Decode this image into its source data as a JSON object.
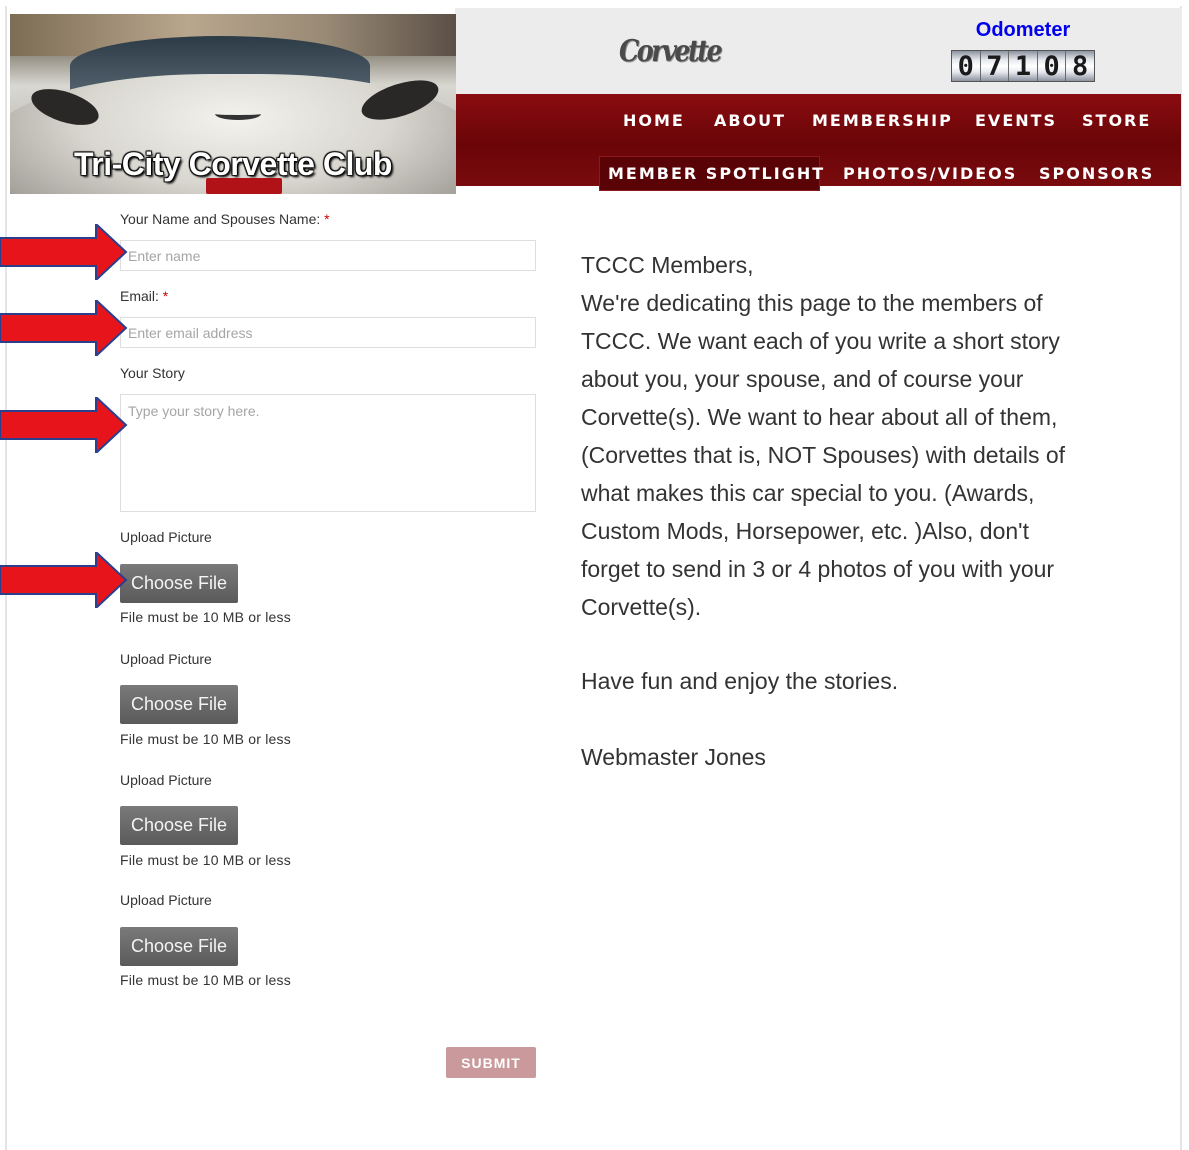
{
  "site": {
    "title": "Tri-City Corvette Club",
    "logo_text": "Corvette",
    "odometer_label": "Odometer",
    "odometer_digits": [
      "0",
      "7",
      "1",
      "0",
      "8"
    ]
  },
  "nav": {
    "row1": [
      "HOME",
      "ABOUT",
      "MEMBERSHIP",
      "EVENTS",
      "STORE"
    ],
    "row2": [
      "MEMBER SPOTLIGHT",
      "PHOTOS/VIDEOS",
      "SPONSORS"
    ],
    "active": "MEMBER SPOTLIGHT"
  },
  "form": {
    "name_label": "Your Name and Spouses Name:",
    "name_placeholder": "Enter name",
    "email_label": "Email:",
    "email_placeholder": "Enter email address",
    "required_mark": "*",
    "story_label": "Your Story",
    "story_placeholder": "Type your story here.",
    "uploads": [
      {
        "label": "Upload Picture",
        "button": "Choose File",
        "note": "File must be 10 MB or less"
      },
      {
        "label": "Upload Picture",
        "button": "Choose File",
        "note": "File must be 10 MB or less"
      },
      {
        "label": "Upload Picture",
        "button": "Choose File",
        "note": "File must be 10 MB or less"
      },
      {
        "label": "Upload Picture",
        "button": "Choose File",
        "note": "File must be 10 MB or less"
      }
    ],
    "submit_label": "SUBMIT"
  },
  "message": {
    "greeting": "TCCC Members,",
    "lines": [
      "We're dedicating this page to the members of",
      "TCCC.  We want each of you write a short story",
      "about you, your spouse, and of course your",
      "Corvette(s).  We want to hear about all of them,",
      "(Corvettes that is, NOT Spouses) with details of",
      "what makes this car special to you. (Awards,",
      "Custom Mods, Horsepower,  etc. )Also, don't",
      "forget to send in 3 or 4 photos of you with your",
      "Corvette(s)."
    ],
    "closing": "Have fun and enjoy the stories.",
    "signature": "Webmaster Jones"
  },
  "colors": {
    "nav_red": "#7a0b0e",
    "annotation_arrow": "#e8141b",
    "odometer_blue": "#0000ee"
  }
}
